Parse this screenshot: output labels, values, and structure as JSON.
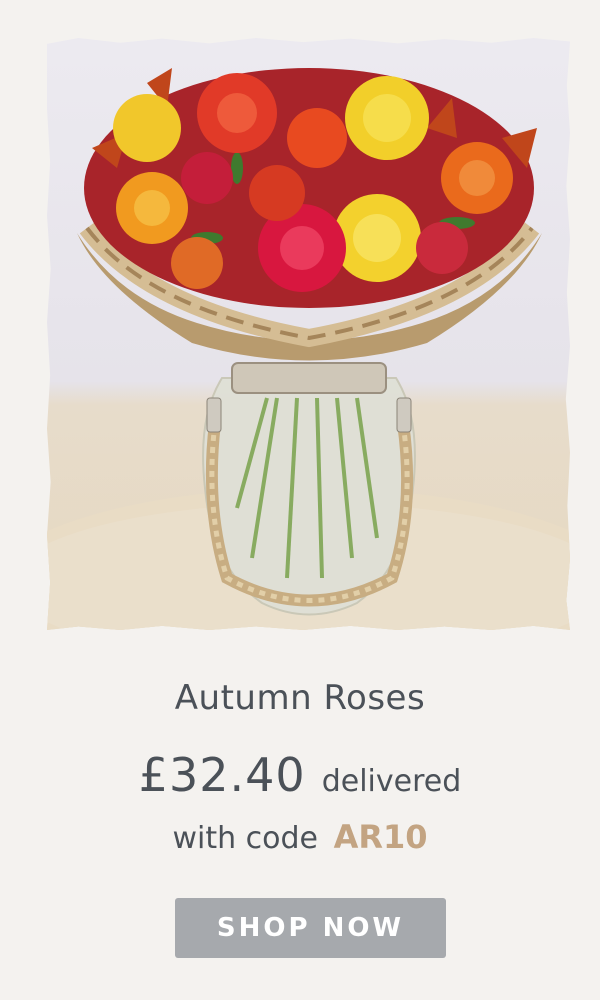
{
  "product": {
    "image_alt": "Autumn roses bouquet in a glass jar vase with rope handle",
    "title": "Autumn Roses",
    "price": "£32.40",
    "price_suffix": "delivered",
    "code_prefix": "with code",
    "code": "AR10"
  },
  "cta": {
    "label": "SHOP NOW"
  },
  "colors": {
    "background": "#f4f2ef",
    "text": "#4b5158",
    "accent": "#c3a482",
    "button": "#a6a9ad",
    "button_text": "#ffffff"
  }
}
